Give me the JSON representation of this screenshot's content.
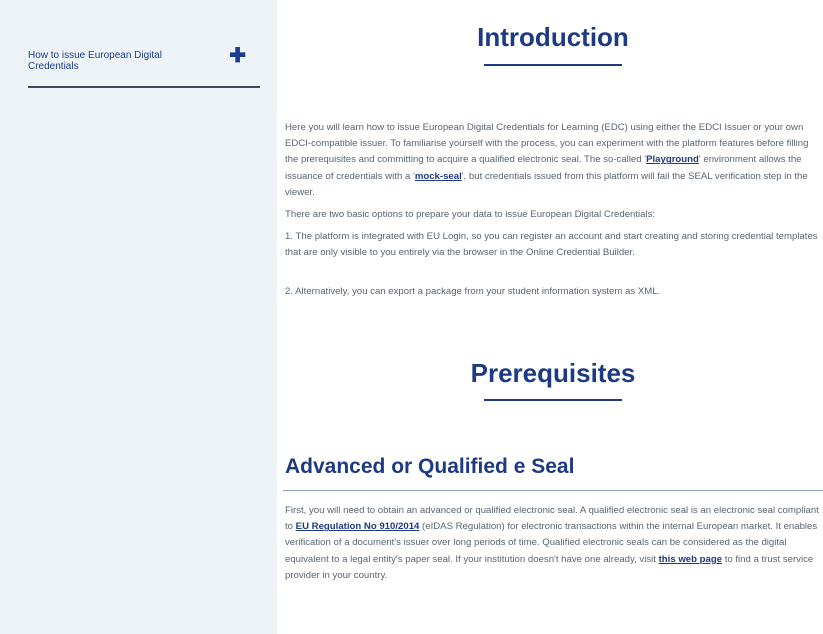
{
  "sidebar": {
    "items": [
      {
        "label": "How to issue European Digital Credentials",
        "icon": "plus-icon"
      }
    ]
  },
  "main": {
    "introduction": {
      "title": "Introduction",
      "p1": {
        "t1": "Here you will learn how to issue European Digital Credentials for Learning (EDC) using either the EDCI Issuer or your own EDCI-compatible issuer.  To familiarise yourself with the process, you can experiment with the platform features before filling the prerequisites and committing to acquire a qualified electronic seal. The so-called '",
        "link1": "Playground",
        "t2": "' environment allows the issuance of credentials with a '",
        "link2": "mock-seal",
        "t3": "', but credentials issued from this platform will fail the SEAL verification step in the viewer."
      },
      "p2": "There are two basic options to prepare your data to issue European Digital Credentials:",
      "p3": "1. The platform is integrated with EU Login, so you can register an account and start creating and storing credential templates that are only visible to you entirely via the browser in the Online Credential Builder.",
      "p4": "2. Alternatively, you can export a package from your student information system as XML."
    },
    "prerequisites": {
      "title": "Prerequisites"
    },
    "eseal": {
      "title": "Advanced or Qualified e Seal",
      "p1": {
        "t1": "First, you will need to obtain an advanced or qualified electronic seal. A qualified electronic seal is an electronic seal compliant to ",
        "link1": "EU Regulation No 910/2014",
        "t2": " (eIDAS Regulation) for electronic transactions within the internal European market. It enables verification of a document's issuer over long periods of time. Qualified electronic seals can be considered as the digital equivalent to a legal entity's paper seal.  If your institution doesn't have one already, visit ",
        "link2": "this web page",
        "t3": " to find a trust service provider in your country."
      }
    }
  },
  "colors": {
    "accent": "#1e3a82",
    "sidebar_bg": "#eef3f8",
    "body_text": "#5a6470"
  }
}
